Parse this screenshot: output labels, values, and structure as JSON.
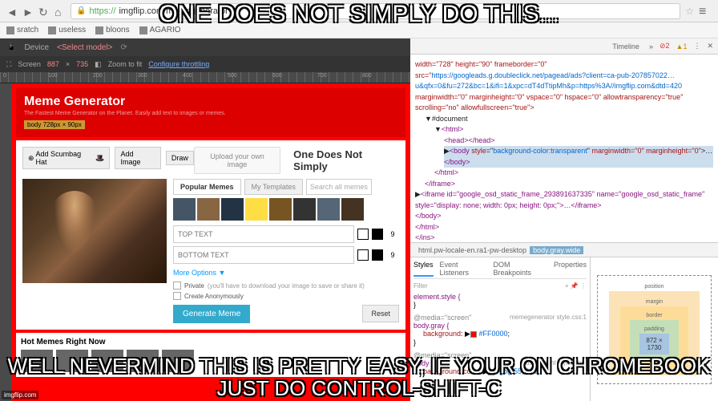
{
  "meme_text": {
    "top": "ONE DOES NOT SIMPLY DO THIS...",
    "bottom": "WELL NEVERMIND THIS IS PRETTY EASY, IF YOUR ON CHROMEBOOK JUST DO CONTROL-SHIFT-C"
  },
  "watermark": "imgflip.com",
  "browser": {
    "url_protocol": "https://",
    "url_rest": "imgflip.com/memegenerator",
    "bookmarks": [
      "sratch",
      "useless",
      "bloons",
      "AGARIO"
    ]
  },
  "devtools": {
    "device_label": "Device",
    "select_model": "<Select model>",
    "screen_label": "Screen",
    "screen_w": "887",
    "screen_h": "735",
    "zoom": "Zoom to fit",
    "throttle": "Configure throttling",
    "timeline_label": "Timeline",
    "errors": "2",
    "warnings": "1",
    "ruler_marks": [
      "0",
      "100",
      "200",
      "300",
      "400",
      "500",
      "600",
      "700",
      "800"
    ],
    "elements_snippet": {
      "iframe_attrs": "width=\"728\" height=\"90\" frameborder=\"0\" src=\"",
      "url1": "https://googleads.g.doubleclick.net/pagead/ads?client=ca-pub-207857022…",
      "url2": "u&qfx=0&fu=272&bc=1&ifi=1&xpc=dT4dTtipMh&p=https%3A//imgflip.com&dtd=420",
      "iframe_rest": " marginwidth=\"0\" marginheight=\"0\" vspace=\"0\" hspace=\"0\" allowtransparency=\"true\" scrolling=\"no\" allowfullscreen=\"true\">",
      "doc": "#document",
      "html": "<html>",
      "head": "<head></head>",
      "body_style": "background-color:transparent",
      "body_attrs": "marginwidth=\"0\" marginheight=\"0\"",
      "body_close": "</body>",
      "html_close": "</html>",
      "iframe_close": "</iframe>",
      "iframe2": "<iframe id=\"google_osd_static_frame_293891637335\" name=\"google_osd_static_frame\" style=\"display: none; width: 0px; height: 0px;\">…</iframe>",
      "ins_close": "</ins>"
    },
    "breadcrumbs": [
      "html.pw-locale-en.ra1-pw-desktop",
      "body.gray.wide"
    ],
    "styles": {
      "tabs": [
        "Styles",
        "Event Listeners",
        "DOM Breakpoints",
        "Properties"
      ],
      "filter": "Filter",
      "element_style": "element.style {",
      "media": "@media=\"screen\"",
      "selector": "body.gray {",
      "source": "memegenerator style.css:1",
      "prop_bg": "background",
      "val_bg": "#FF0000",
      "selector2": "body {",
      "user_agent": "user agent stylesheet",
      "prop_bgc": "background-color",
      "val_bgc": "rgb(255, 0, 0)"
    },
    "box_model": {
      "position": "position",
      "margin": "margin",
      "border": "border",
      "padding": "padding",
      "content": "872 × 1730"
    }
  },
  "meme_site": {
    "title": "Meme Generator",
    "subtitle": "The Fastest Meme Generator on the Planet. Easily add text to images or memes.",
    "body_size": "body 728px × 90px",
    "tools": {
      "scumbag": "Add Scumbag Hat",
      "addimage": "Add Image",
      "draw": "Draw"
    },
    "upload": "Upload your own image",
    "template_name": "One Does Not Simply",
    "tabs": {
      "popular": "Popular Memes",
      "my": "My Templates",
      "search": "Search all memes"
    },
    "top_placeholder": "TOP TEXT",
    "bottom_placeholder": "BOTTOM TEXT",
    "font_size": "9",
    "more_options": "More Options ▼",
    "private_label": "Private",
    "private_note": "(you'll have to download your image to save or share it)",
    "anon_label": "Create Anonymously",
    "generate": "Generate Meme",
    "reset": "Reset",
    "hot_title": "Hot Memes Right Now"
  }
}
